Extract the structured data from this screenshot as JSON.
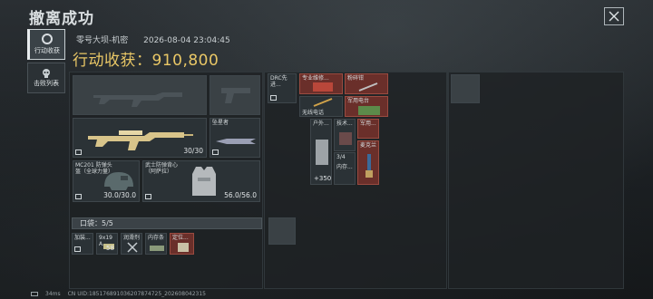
{
  "header": {
    "title": "撤离成功",
    "close_label": "×"
  },
  "sidebar": {
    "tabs": [
      {
        "label": "行动收获"
      },
      {
        "label": "击败列表"
      }
    ]
  },
  "meta": {
    "map": "零号大坝-机密",
    "datetime": "2026-08-04 23:04:45"
  },
  "gain": {
    "label": "行动收获：",
    "value": "910,800"
  },
  "equipment": {
    "gun2_ammo": "30/30",
    "melee_name": "坠星者",
    "helmet": {
      "name": "MC201 防弹头盔（全球力量）",
      "dur": "30.0/30.0"
    },
    "armor": {
      "name": "武士防弹背心（阿萨拉）",
      "dur": "56.0/56.0"
    }
  },
  "pocket": {
    "label": "口袋：",
    "count": "5/5",
    "items": [
      {
        "name": "加装..."
      },
      {
        "name": "9x19 A...",
        "count": "58"
      },
      {
        "name": "润滑剂"
      },
      {
        "name": "内存条"
      },
      {
        "name": "定位..."
      }
    ]
  },
  "backpack": {
    "items": [
      {
        "name": "DRC先进..."
      },
      {
        "name": "专业维修..."
      },
      {
        "name": "粉碎钳"
      },
      {
        "name": "无线电话"
      },
      {
        "name": "军用电台"
      },
      {
        "name": "户外..."
      },
      {
        "name": "技术..."
      },
      {
        "name": "军用..."
      },
      {
        "name": "内存...",
        "count": "3/4"
      },
      {
        "name": "麦克兰"
      },
      {
        "name": "+350"
      }
    ]
  },
  "status": {
    "ping": "34ms",
    "uid": "CN UID:185176891036207874725_202608042315"
  }
}
